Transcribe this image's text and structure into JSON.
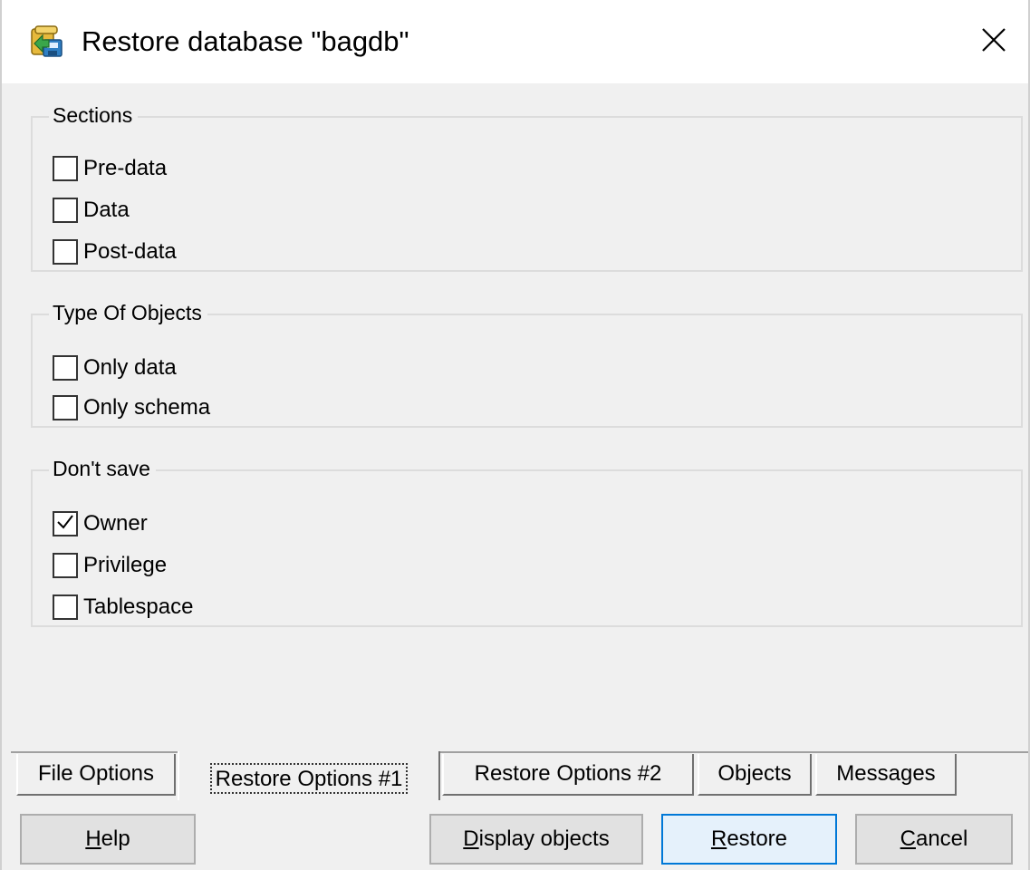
{
  "window": {
    "title": "Restore database \"bagdb\"",
    "close_glyph": "✕"
  },
  "sections": {
    "legend": "Sections",
    "items": [
      {
        "label": "Pre-data",
        "checked": false
      },
      {
        "label": "Data",
        "checked": false
      },
      {
        "label": "Post-data",
        "checked": false
      }
    ]
  },
  "type_of_objects": {
    "legend": "Type Of Objects",
    "items": [
      {
        "label": "Only data",
        "checked": false
      },
      {
        "label": "Only schema",
        "checked": false
      }
    ]
  },
  "dont_save": {
    "legend": "Don't save",
    "items": [
      {
        "label": "Owner",
        "checked": true
      },
      {
        "label": "Privilege",
        "checked": false
      },
      {
        "label": "Tablespace",
        "checked": false
      }
    ]
  },
  "tabs": [
    {
      "label": "File Options",
      "active": false
    },
    {
      "label": "Restore Options #1",
      "active": true
    },
    {
      "label": "Restore Options #2",
      "active": false
    },
    {
      "label": "Objects",
      "active": false
    },
    {
      "label": "Messages",
      "active": false
    }
  ],
  "buttons": {
    "help": {
      "label": "Help",
      "mnemonic": "H",
      "rest": "elp"
    },
    "display_objects": {
      "label": "Display objects",
      "mnemonic": "D",
      "rest": "isplay objects"
    },
    "restore": {
      "label": "Restore",
      "mnemonic": "R",
      "rest": "estore"
    },
    "cancel": {
      "label": "Cancel",
      "mnemonic": "C",
      "rest": "ancel"
    }
  },
  "icons": {
    "app": "restore-database-icon",
    "close": "close-icon",
    "check": "checkmark-icon"
  },
  "colors": {
    "accent": "#0078d7",
    "window_bg": "#f0f0f0"
  }
}
